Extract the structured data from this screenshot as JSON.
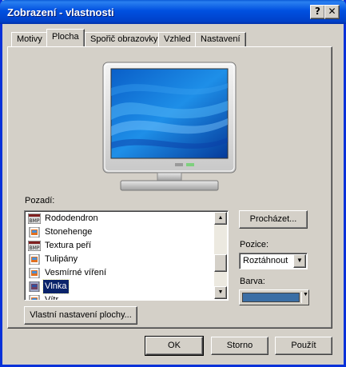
{
  "window": {
    "title": "Zobrazení - vlastnosti",
    "help_label": "?",
    "close_label": "✕"
  },
  "tabs": [
    {
      "label": "Motivy",
      "active": false
    },
    {
      "label": "Plocha",
      "active": true
    },
    {
      "label": "Spořič obrazovky",
      "active": false
    },
    {
      "label": "Vzhled",
      "active": false
    },
    {
      "label": "Nastavení",
      "active": false
    }
  ],
  "background": {
    "label": "Pozadí:",
    "items": [
      {
        "name": "Rododendron",
        "icon": "bmp-file-icon",
        "selected": false
      },
      {
        "name": "Stonehenge",
        "icon": "jpg-file-icon",
        "selected": false
      },
      {
        "name": "Textura peří",
        "icon": "bmp-file-icon",
        "selected": false
      },
      {
        "name": "Tulipány",
        "icon": "jpg-file-icon",
        "selected": false
      },
      {
        "name": "Vesmírné víření",
        "icon": "jpg-file-icon",
        "selected": false
      },
      {
        "name": "Vlnka",
        "icon": "jpg-file-icon",
        "selected": true
      },
      {
        "name": "Vítr",
        "icon": "jpg-file-icon",
        "selected": false
      }
    ]
  },
  "browse_label": "Procházet...",
  "position": {
    "label": "Pozice:",
    "value": "Roztáhnout"
  },
  "color": {
    "label": "Barva:",
    "value": "#3a6ea5"
  },
  "customize_label": "Vlastní nastavení plochy...",
  "footer": {
    "ok": "OK",
    "cancel": "Storno",
    "apply": "Použít"
  },
  "colors": {
    "title_bar": "#0050e0",
    "face": "#d4d0c8",
    "selection": "#0a246a"
  }
}
